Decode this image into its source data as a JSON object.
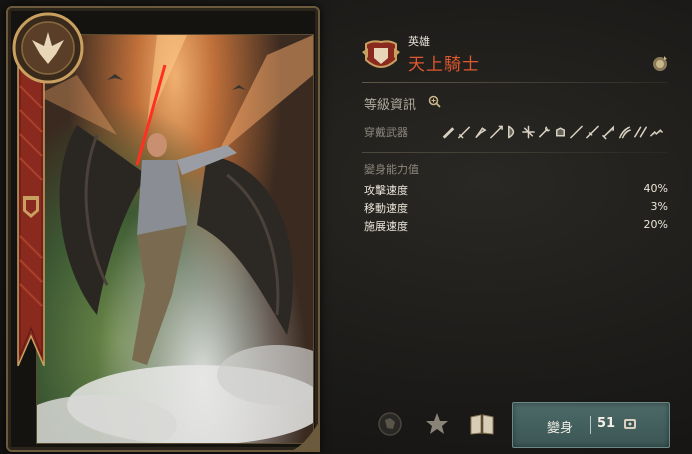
{
  "hero": {
    "type": "英雄",
    "name": "天上騎士"
  },
  "level_info": {
    "title": "等級資訊",
    "weapon_label": "穿戴武器",
    "weapons": [
      "dagger-icon",
      "sword-icon",
      "axe-icon",
      "spear-icon",
      "bow-icon",
      "crossbow-icon",
      "staff-icon",
      "gauntlet-icon",
      "wand-icon",
      "rapier-icon",
      "greatsword-icon",
      "claw-icon",
      "dual-blade-icon",
      "chain-icon"
    ]
  },
  "stats": {
    "title": "變身能力值",
    "rows": [
      {
        "label": "攻擊速度",
        "value": "40%"
      },
      {
        "label": "移動速度",
        "value": "3%"
      },
      {
        "label": "施展速度",
        "value": "20%"
      }
    ]
  },
  "actions": {
    "transform_label": "變身",
    "transform_count": "51"
  },
  "colors": {
    "hero_name": "#e0582e",
    "button_bg": "#4d6a68",
    "gold_frame": "#6b5a3c"
  }
}
